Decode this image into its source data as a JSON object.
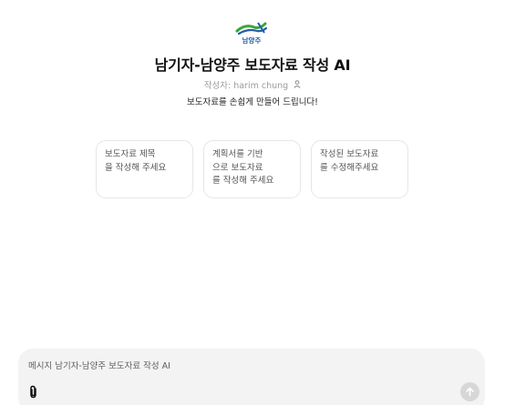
{
  "header": {
    "logo_text": "남양주",
    "title": "남기자-남양주 보도자료 작성 AI",
    "author_label": "작성자:",
    "author_name": "harim chung",
    "author_icon": "person-icon",
    "description": "보도자료를 손쉽게 만들어 드립니다!"
  },
  "suggestions": [
    {
      "lines": [
        "보도자료 제목",
        "을 작성해 주세요"
      ]
    },
    {
      "lines": [
        "계획서를 기반",
        "으로 보도자료",
        "를 작성해 주세요"
      ]
    },
    {
      "lines": [
        "작성된 보도자료",
        "를 수정해주세요"
      ]
    }
  ],
  "composer": {
    "placeholder": "메시지 남기자-남양주 보도자료 작성 AI",
    "attach_icon": "paperclip-icon",
    "send_icon": "arrow-up-icon"
  },
  "colors": {
    "logo_green": "#3aa53a",
    "logo_blue": "#1f5fa8",
    "composer_bg": "#f3f3f3",
    "send_disabled": "#d7d7d7"
  }
}
